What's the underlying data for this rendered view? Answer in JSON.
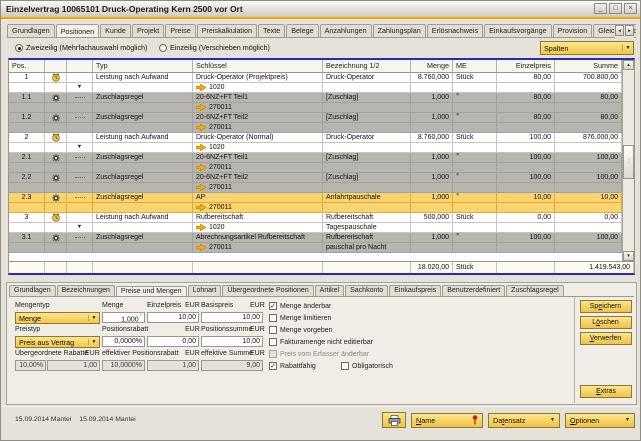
{
  "window": {
    "title": "Einzelvertrag 10065101 Druck-Operating Kern 2500 vor Ort"
  },
  "icons": {
    "dropdown": "▼",
    "collapse": "▼",
    "scroll_up": "▲",
    "scroll_down": "▼",
    "tab_prev": "◄",
    "tab_next": "►",
    "check": "✓",
    "minimize": "_",
    "maximize": "□",
    "close": "×",
    "thumb_grip": "⋮"
  },
  "tabs": {
    "labels": [
      "Grundlagen",
      "Positionen",
      "Kunde",
      "Projekt",
      "Preise",
      "Preiskalkulation",
      "Texte",
      "Belege",
      "Anzahlungen",
      "Zahlungsplan",
      "Erlösnachweis",
      "Einkaufsvorgänge",
      "Provision",
      "Gleichgewicht"
    ],
    "active": "Positionen"
  },
  "view_options": {
    "radio_two_line": "Zweizeilig (Mehrfachauswahl möglich)",
    "radio_one_line": "Einzeilig (Verschieben möglich)",
    "selected": "radio_two_line",
    "columns_dropdown": "Spalten"
  },
  "table": {
    "headers": [
      "Pos.",
      "",
      "",
      "Typ",
      "Schlüssel",
      "Bezeichnung 1/2",
      "Menge",
      "ME",
      "Einzelpreis",
      "Summe"
    ],
    "rows": [
      {
        "pos": "1",
        "icon": "clock",
        "typ": "Leistung nach Aufwand",
        "schl": "Druck-Operator (Projektpreis)",
        "bez": "Druck-Operator",
        "menge": "8.760,000",
        "me": "Stück",
        "ep": "80,00",
        "summe": "700.800,00",
        "style": "white"
      },
      {
        "sub": true,
        "exp": true,
        "arrow": true,
        "schl": "1020",
        "style": "white"
      },
      {
        "pos": "1.1",
        "icon": "gear",
        "tree": true,
        "typ": "Zuschlagsregel",
        "schl": "20-6NZ+FT Teil1",
        "bez": "[Zuschlag]",
        "menge": "1,000",
        "me": "×",
        "me_sup": true,
        "ep": "80,00",
        "summe": "80,00",
        "style": "gray"
      },
      {
        "sub": true,
        "arrow": true,
        "schl": "270011",
        "style": "gray"
      },
      {
        "pos": "1.2",
        "icon": "gear",
        "tree": true,
        "typ": "Zuschlagsregel",
        "schl": "20-6NZ+FT Teil2",
        "bez": "[Zuschlag]",
        "menge": "1,000",
        "me": "×",
        "me_sup": true,
        "ep": "80,00",
        "summe": "80,00",
        "style": "gray"
      },
      {
        "sub": true,
        "arrow": true,
        "schl": "270011",
        "style": "gray"
      },
      {
        "pos": "2",
        "icon": "clock",
        "typ": "Leistung nach Aufwand",
        "schl": "Druck-Operator (Normal)",
        "bez": "Druck-Operator",
        "menge": "8.760,000",
        "me": "Stück",
        "ep": "100,00",
        "summe": "876.000,00",
        "style": "white"
      },
      {
        "sub": true,
        "exp": true,
        "arrow": true,
        "schl": "1020",
        "style": "white"
      },
      {
        "pos": "2.1",
        "icon": "gear",
        "tree": true,
        "typ": "Zuschlagsregel",
        "schl": "20-6NZ+FT Teil1",
        "bez": "[Zuschlag]",
        "menge": "1,000",
        "me": "×",
        "me_sup": true,
        "ep": "100,00",
        "summe": "100,00",
        "style": "gray"
      },
      {
        "sub": true,
        "arrow": true,
        "schl": "270011",
        "style": "gray"
      },
      {
        "pos": "2.2",
        "icon": "gear",
        "tree": true,
        "typ": "Zuschlagsregel",
        "schl": "20-6NZ+FT Teil2",
        "bez": "[Zuschlag]",
        "menge": "1,000",
        "me": "×",
        "me_sup": true,
        "ep": "100,00",
        "summe": "100,00",
        "style": "gray"
      },
      {
        "sub": true,
        "arrow": true,
        "schl": "270011",
        "style": "gray"
      },
      {
        "pos": "2.3",
        "icon": "gear",
        "tree": true,
        "typ": "Zuschlagsregel",
        "schl": "AP",
        "bez": "Anfahrtpauschale",
        "menge": "1,000",
        "me": "×",
        "me_sup": true,
        "ep": "10,00",
        "summe": "10,00",
        "style": "selected"
      },
      {
        "sub": true,
        "arrow": true,
        "schl": "270011",
        "style": "selected"
      },
      {
        "pos": "3",
        "icon": "clock",
        "typ": "Leistung nach Aufwand",
        "schl": "Rufbereitschaft",
        "bez": "Rufbereitschaft",
        "menge": "500,000",
        "me": "Stück",
        "ep": "0,00",
        "summe": "0,00",
        "style": "white"
      },
      {
        "sub": true,
        "exp": true,
        "arrow": true,
        "schl": "1020",
        "bez": "Tagespauschale",
        "style": "white"
      },
      {
        "pos": "3.1",
        "icon": "gear",
        "tree": true,
        "typ": "Zuschlagsregel",
        "schl": "Abrechnungsartikel Rufbereitschaft",
        "bez": "Rufbereitschaft",
        "menge": "1,000",
        "me": "×",
        "me_sup": true,
        "ep": "100,00",
        "summe": "100,00",
        "style": "gray"
      },
      {
        "sub": true,
        "arrow": true,
        "schl": "270011",
        "bez": "pauschal pro Nacht",
        "style": "gray"
      }
    ],
    "total": {
      "menge": "18.020,00",
      "me": "Stück",
      "summe": "1.419.543,00"
    }
  },
  "detail": {
    "tabs": [
      "Grundlagen",
      "Bezeichnungen",
      "Preise und Mengen",
      "Lohnart",
      "Übergeordnete Positionen",
      "Artikel",
      "Sachkonto",
      "Einkaufspreis",
      "Benutzerdefiniert",
      "Zuschlagsregel"
    ],
    "active": "Preise und Mengen",
    "labels": {
      "mengentyp": "Mengentyp",
      "menge": "Menge",
      "einzelpreis": "Einzelpreis",
      "eur1": "EUR",
      "basispreis": "Basispreis",
      "eur2": "EUR",
      "preistyp": "Preistyp",
      "positionsrabatt": "Positionsrabatt",
      "eur3": "EUR",
      "positionssumme": "Positionssumme",
      "eur4": "EUR",
      "uebergeordnete_rabatte": "Übergeordnete Rabatte",
      "eur5": "EUR",
      "effektiver_positionsrabatt": "effektiver Positionsrabatt",
      "eur6": "EUR",
      "effektive_summe": "effektive Summe",
      "eur7": "EUR"
    },
    "values": {
      "mengentyp": "Menge",
      "menge": "1,000",
      "menge_footnote": "*",
      "einzelpreis": "10,00",
      "basispreis": "10,00",
      "preistyp": "Preis aus Vertrag",
      "positionsrabatt": "0,0000%",
      "positionsrabatt_eur": "0,00",
      "positionssumme": "10,00",
      "ueberg_rabatte_pct": "10,00%",
      "ueberg_rabatte_eur": "1,00",
      "eff_posrabatt_pct": "10,0000%",
      "eff_posrabatt_eur": "1,00",
      "eff_summe": "9,00"
    },
    "checkboxes": [
      {
        "label": "Menge änderbar",
        "checked": true,
        "disabled": false
      },
      {
        "label": "Menge limitieren",
        "checked": false,
        "disabled": false
      },
      {
        "label": "Menge vorgeben",
        "checked": false,
        "disabled": false
      },
      {
        "label": "Fakturamenge nicht editierbar",
        "checked": false,
        "disabled": false
      },
      {
        "label": "Preis vom Erfasser änderbar",
        "checked": false,
        "disabled": true
      },
      {
        "label": "Rabattfähig",
        "checked": true,
        "disabled": false
      },
      {
        "label": "Obligatorisch",
        "checked": false,
        "disabled": false
      }
    ],
    "buttons": {
      "save": {
        "label": "Speichern",
        "hotkey": 2
      },
      "delete": {
        "label": "Löschen",
        "hotkey": 1
      },
      "discard": {
        "label": "Verwerfen",
        "hotkey": 0
      },
      "extras": {
        "label": "Extras",
        "hotkey": 0
      }
    }
  },
  "statusbar": {
    "created": "15.09.2014 Mantei",
    "updated": "15.09.2014 Mantei",
    "buttons": {
      "name": {
        "label": "Name",
        "hotkey": 0
      },
      "datensatz": {
        "label": "Datensatz",
        "hotkey": 2
      },
      "optionen": {
        "label": "Optionen",
        "hotkey": 0
      }
    }
  }
}
